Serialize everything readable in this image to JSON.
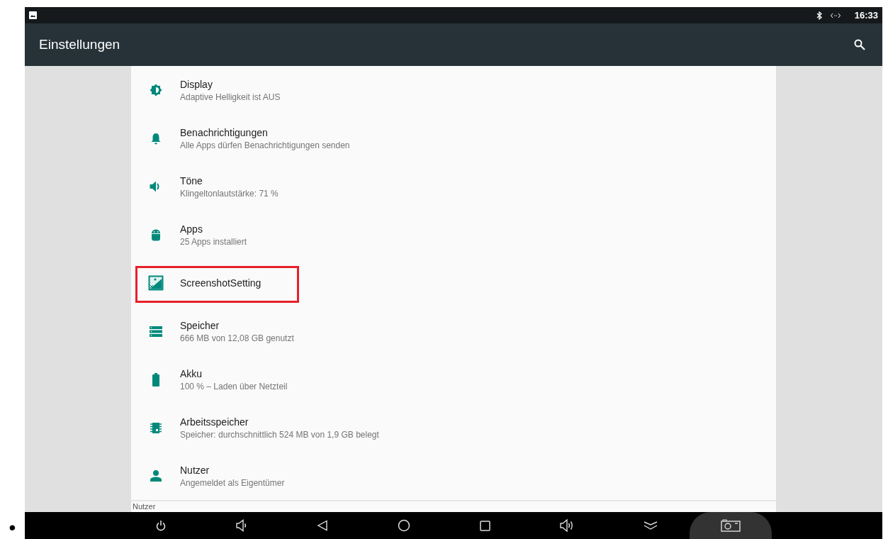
{
  "status_bar": {
    "time": "16:33"
  },
  "toolbar": {
    "title": "Einstellungen"
  },
  "settings": [
    {
      "title": "Display",
      "summary": "Adaptive Helligkeit ist AUS",
      "highlighted": false
    },
    {
      "title": "Benachrichtigungen",
      "summary": "Alle Apps dürfen Benachrichtigungen senden",
      "highlighted": false
    },
    {
      "title": "Töne",
      "summary": "Klingeltonlautstärke: 71 %",
      "highlighted": false
    },
    {
      "title": "Apps",
      "summary": "25 Apps installiert",
      "highlighted": false
    },
    {
      "title": "ScreenshotSetting",
      "highlighted": true
    },
    {
      "title": "Speicher",
      "summary": "666 MB von 12,08 GB genutzt",
      "highlighted": false
    },
    {
      "title": "Akku",
      "summary": "100 % – Laden über Netzteil",
      "highlighted": false
    },
    {
      "title": "Arbeitsspeicher",
      "summary": "Speicher: durchschnittlich 524 MB von 1,9 GB belegt",
      "highlighted": false
    },
    {
      "title": "Nutzer",
      "summary": "Angemeldet als Eigentümer",
      "highlighted": false
    }
  ],
  "section_header": "Nutzer",
  "bullet": "•"
}
